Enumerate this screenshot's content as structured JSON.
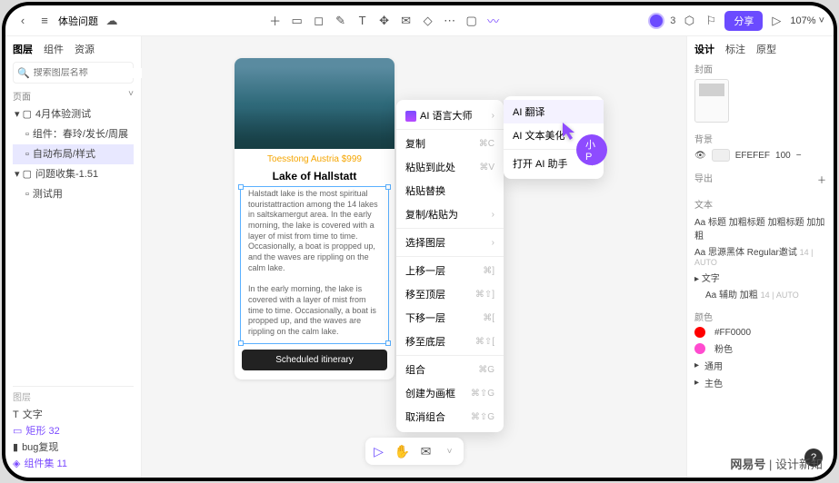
{
  "topbar": {
    "doc_title": "体验问题",
    "user_count": "3",
    "share": "分享",
    "zoom": "107%"
  },
  "left": {
    "tabs": [
      "图层",
      "组件",
      "资源"
    ],
    "search_placeholder": "搜索图层名称",
    "pages_label": "页面",
    "tree": {
      "g1": "4月体验测试",
      "g1a": "组件：春玲/发长/周展",
      "g1b": "自动布局/样式",
      "g2": "问题收集-1.51",
      "g2a": "测试用"
    },
    "bottom_label": "图层",
    "items": {
      "t": "文字",
      "r": "矩形 32",
      "b": "bug复现",
      "c": "组件集 11"
    }
  },
  "card": {
    "subtitle": "Toesstong Austria $999",
    "title": "Lake of Hallstatt",
    "body1": "Halstadt lake is the most spiritual touristattraction among the 14 lakes in saltskamergut area. In the early morning, the lake is covered with a layer of mist from time to time. Occasionally, a boat is propped up, and the waves are rippling on the calm lake.",
    "body2": "In the early morning, the lake is covered with a layer of mist from time to time. Occasionally, a boat is propped up, and the waves are rippling on the calm lake.",
    "button": "Scheduled itinerary"
  },
  "ctx1": {
    "ai": "AI 语言大师",
    "copy": "复制",
    "copy_sc": "⌘C",
    "paste_here": "粘贴到此处",
    "paste_here_sc": "⌘V",
    "paste_replace": "粘贴替换",
    "copy_paste_as": "复制/粘贴为",
    "select_layer": "选择图层",
    "up": "上移一层",
    "up_sc": "⌘]",
    "top": "移至顶层",
    "top_sc": "⌘⇧]",
    "down": "下移一层",
    "down_sc": "⌘[",
    "bottom": "移至底层",
    "bottom_sc": "⌘⇧[",
    "group": "组合",
    "group_sc": "⌘G",
    "make_frame": "创建为画框",
    "make_frame_sc": "⌘⇧G",
    "ungroup": "取消组合",
    "ungroup_sc": "⌘⇧G"
  },
  "ctx2": {
    "translate": "AI 翻译",
    "beautify": "AI 文本美化",
    "open_helper": "打开 AI 助手"
  },
  "bubble": "小P",
  "right": {
    "tabs": [
      "设计",
      "标注",
      "原型"
    ],
    "cover": "封面",
    "bg": "背景",
    "bg_color": "EFEFEF",
    "bg_opacity": "100",
    "export": "导出",
    "text": "文本",
    "t1": "标题 加粗标题 加粗标题 加加粗",
    "t1pre": "Aa",
    "t2": "思源黑体 Regular邀试",
    "t2meta": "14 | AUTO",
    "t2pre": "Aa",
    "t3_label": "文字",
    "t3": "辅助 加粗",
    "t3meta": "14 | AUTO",
    "t3pre": "Aa",
    "colors": "颜色",
    "c1": "#FF0000",
    "c2": "粉色",
    "c3": "通用",
    "c4": "主色"
  },
  "watermark_a": "网易号",
  "watermark_b": "设计新知"
}
